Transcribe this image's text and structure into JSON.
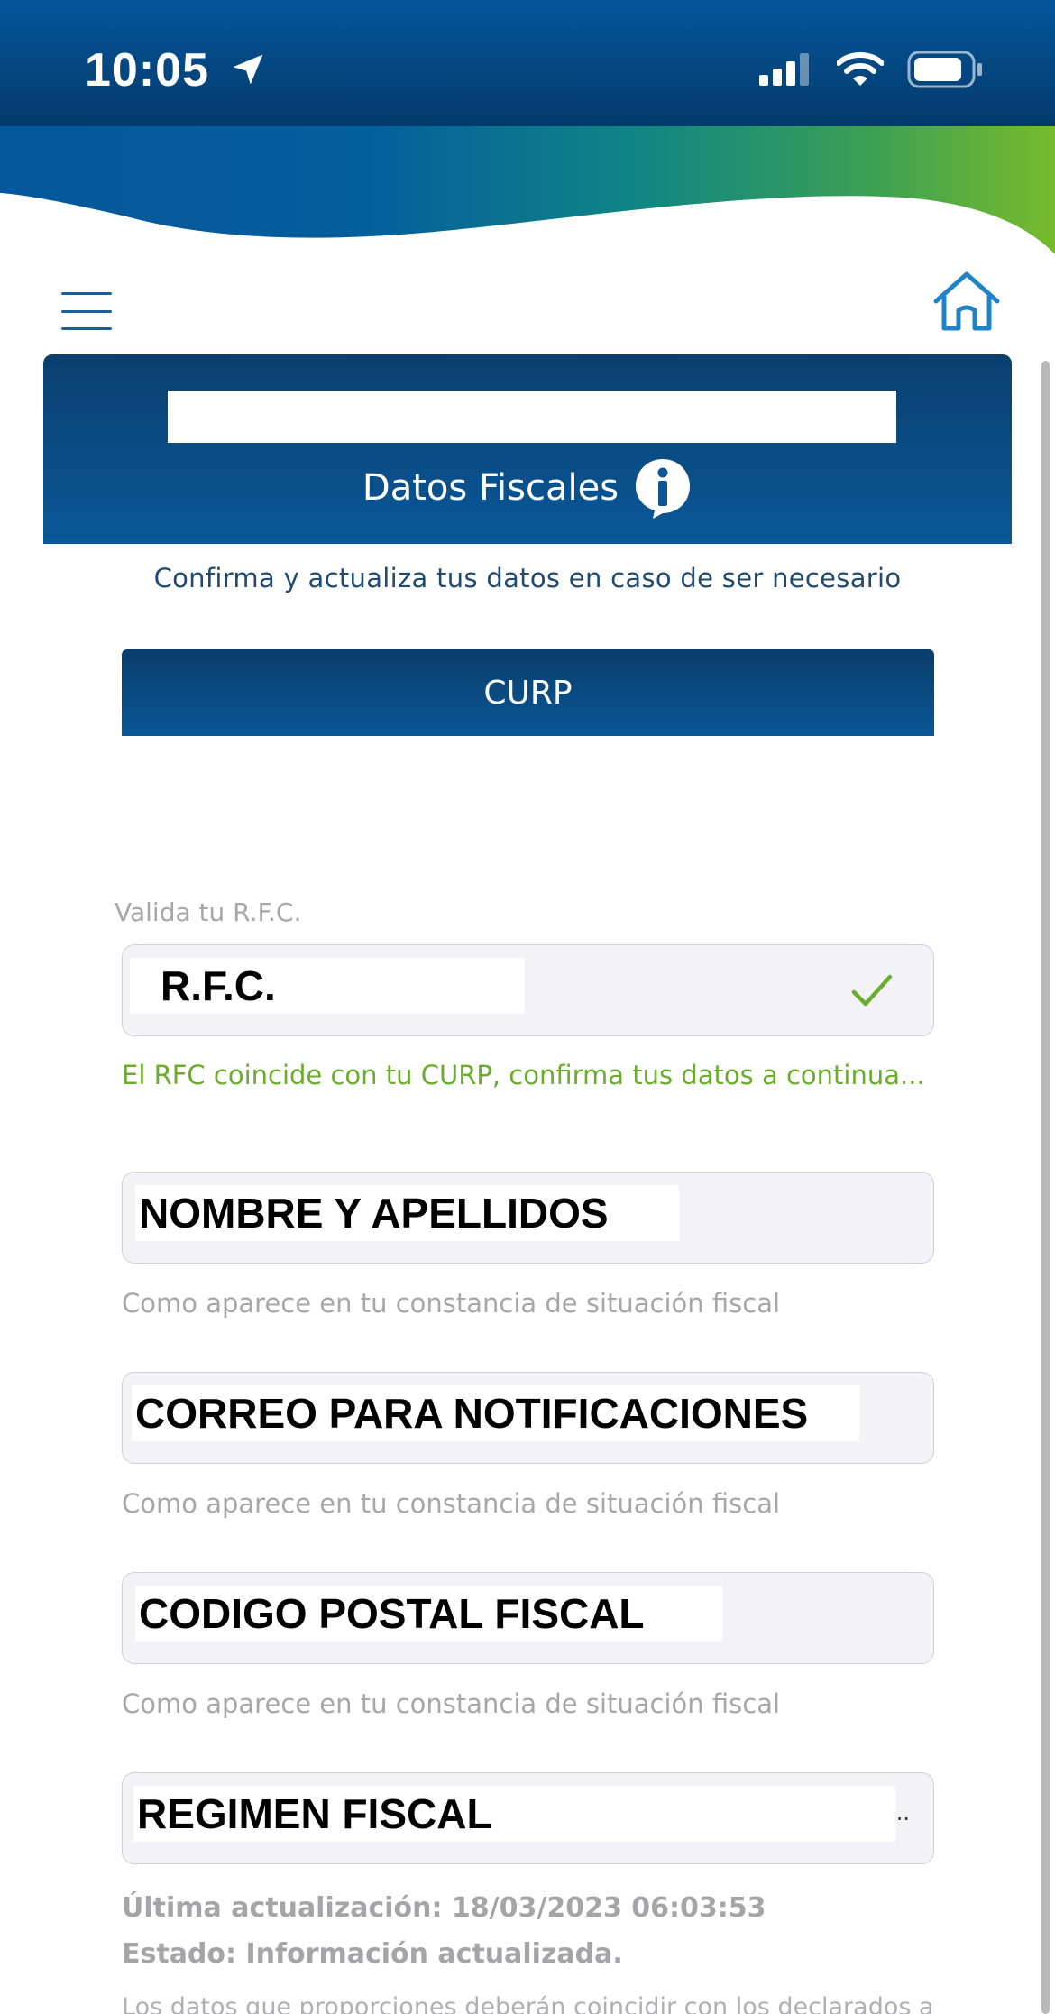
{
  "status_bar": {
    "time": "10:05"
  },
  "icons": {
    "menu": "hamburger-menu-icon",
    "home": "home-icon",
    "info": "info-icon",
    "check": "checkmark-icon",
    "location": "location-arrow-icon",
    "signal": "cellular-signal-icon",
    "wifi": "wifi-icon",
    "battery": "battery-icon"
  },
  "colors": {
    "brand_blue": "#0a5898",
    "brand_green": "#6ab42f",
    "success_green": "#6aac2b"
  },
  "header": {
    "title": "Datos Fiscales",
    "subtitle": "Confirma y actualiza tus datos en caso de ser necesario"
  },
  "curp_button": {
    "label": "CURP"
  },
  "form": {
    "rfc_label": "Valida tu R.F.C.",
    "rfc_value": "R.F.C.",
    "rfc_success": "El RFC coincide con tu CURP, confirma tus datos a continua...",
    "name_value": "NOMBRE Y APELLIDOS",
    "name_help": "Como aparece en tu constancia de situación fiscal",
    "email_value": "CORREO PARA NOTIFICACIONES",
    "email_help": "Como aparece en tu constancia de situación fiscal",
    "zip_value": "CODIGO POSTAL FISCAL",
    "zip_help": "Como aparece en tu constancia de situación fiscal",
    "regime_value": "REGIMEN FISCAL",
    "regime_trailing": ".."
  },
  "meta": {
    "last_update": "Última actualización: 18/03/2023 06:03:53",
    "status": "Estado: Información actualizada.",
    "disclaimer": "Los datos que proporciones deberán coincidir con los declarados ante la"
  }
}
